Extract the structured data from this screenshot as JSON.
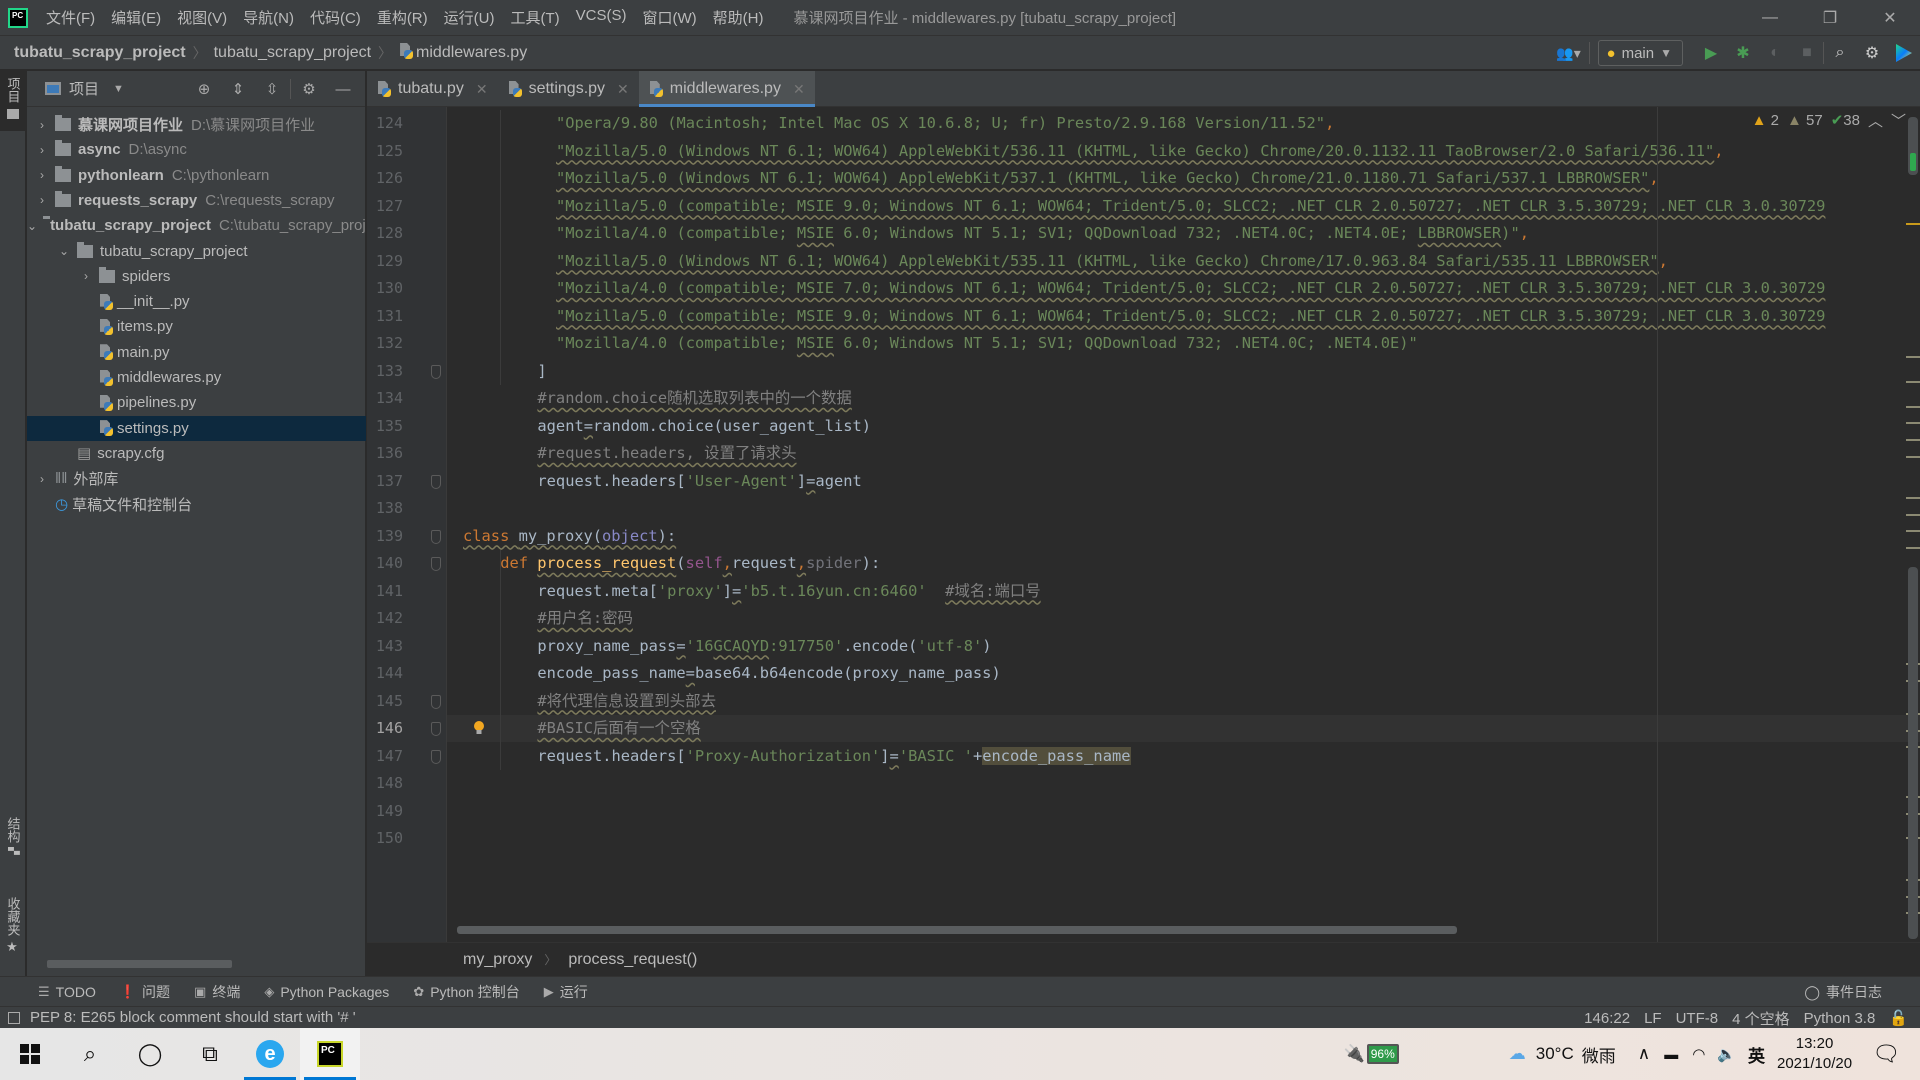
{
  "titlebar": {
    "app_icon": "pycharm-logo",
    "menu": [
      "文件(F)",
      "编辑(E)",
      "视图(V)",
      "导航(N)",
      "代码(C)",
      "重构(R)",
      "运行(U)",
      "工具(T)",
      "VCS(S)",
      "窗口(W)",
      "帮助(H)"
    ],
    "window_title": "慕课网项目作业 - middlewares.py [tubatu_scrapy_project]",
    "controls": {
      "minimize": "—",
      "restore": "❐",
      "close": "✕"
    }
  },
  "navbar": {
    "breadcrumb": [
      "tubatu_scrapy_project",
      "tubatu_scrapy_project",
      "middlewares.py"
    ],
    "run_config": "main",
    "icons": [
      "vcs-user-icon",
      "run-icon",
      "debug-icon",
      "coverage-icon",
      "stop-icon",
      "search-icon",
      "settings-icon",
      "jetbrains-toolbox-icon"
    ]
  },
  "left_strip": {
    "top_tab": "项目",
    "bottom_tabs": [
      "结构",
      "收藏夹"
    ]
  },
  "project_panel": {
    "title": "项目",
    "tree": [
      {
        "name": "慕课网项目作业",
        "path": "D:\\慕课网项目作业",
        "bold": true,
        "type": "folder",
        "expanded": false,
        "depth": 0
      },
      {
        "name": "async",
        "path": "D:\\async",
        "bold": true,
        "type": "folder",
        "expanded": false,
        "depth": 0
      },
      {
        "name": "pythonlearn",
        "path": "C:\\pythonlearn",
        "bold": true,
        "type": "folder",
        "expanded": false,
        "depth": 0
      },
      {
        "name": "requests_scrapy",
        "path": "C:\\requests_scrapy",
        "bold": true,
        "type": "folder",
        "expanded": false,
        "depth": 0
      },
      {
        "name": "tubatu_scrapy_project",
        "path": "C:\\tubatu_scrapy_project",
        "bold": true,
        "type": "folder",
        "expanded": true,
        "depth": 0
      },
      {
        "name": "tubatu_scrapy_project",
        "path": "",
        "bold": false,
        "type": "package",
        "expanded": true,
        "depth": 1
      },
      {
        "name": "spiders",
        "path": "",
        "bold": false,
        "type": "package",
        "expanded": false,
        "depth": 2
      },
      {
        "name": "__init__.py",
        "path": "",
        "bold": false,
        "type": "python",
        "depth": 2
      },
      {
        "name": "items.py",
        "path": "",
        "bold": false,
        "type": "python",
        "depth": 2
      },
      {
        "name": "main.py",
        "path": "",
        "bold": false,
        "type": "python",
        "depth": 2
      },
      {
        "name": "middlewares.py",
        "path": "",
        "bold": false,
        "type": "python",
        "depth": 2
      },
      {
        "name": "pipelines.py",
        "path": "",
        "bold": false,
        "type": "python",
        "depth": 2
      },
      {
        "name": "settings.py",
        "path": "",
        "bold": false,
        "type": "python",
        "depth": 2,
        "selected": true
      },
      {
        "name": "scrapy.cfg",
        "path": "",
        "bold": false,
        "type": "file",
        "depth": 1
      },
      {
        "name": "外部库",
        "path": "",
        "bold": false,
        "type": "library",
        "expanded": false,
        "depth": 0
      },
      {
        "name": "草稿文件和控制台",
        "path": "",
        "bold": false,
        "type": "scratch",
        "depth": 0
      }
    ]
  },
  "editor_tabs": [
    {
      "label": "tubatu.py",
      "active": false
    },
    {
      "label": "settings.py",
      "active": false
    },
    {
      "label": "middlewares.py",
      "active": true
    }
  ],
  "inspections": {
    "errors": "2",
    "warnings": "57",
    "typos": "38"
  },
  "code": {
    "current_line": 146,
    "lines": [
      {
        "n": 124,
        "indent": 10,
        "tokens": [
          [
            "s",
            "\"Opera/9.80 (Macintosh; Intel Mac OS X 10.6.8; U; fr) Presto/2.9.168 Version/11.52\""
          ],
          [
            "k",
            ","
          ]
        ]
      },
      {
        "n": 125,
        "indent": 10,
        "tokens": [
          [
            "s u",
            "\"Mozilla/5.0 (Windows NT 6.1; WOW64) AppleWebKit/536.11 (KHTML, like Gecko) Chrome/20.0.1132.11 TaoBrowser/2.0 Safari/536.11\""
          ],
          [
            "k",
            ","
          ]
        ]
      },
      {
        "n": 126,
        "indent": 10,
        "tokens": [
          [
            "s u",
            "\"Mozilla/5.0 (Windows NT 6.1; WOW64) AppleWebKit/537.1 (KHTML, like Gecko) Chrome/21.0.1180.71 Safari/537.1 LBBROWSER\""
          ],
          [
            "k",
            ","
          ]
        ]
      },
      {
        "n": 127,
        "indent": 10,
        "tokens": [
          [
            "s u",
            "\"Mozilla/5.0 (compatible; MSIE 9.0; Windows NT 6.1; WOW64; Trident/5.0; SLCC2; .NET CLR 2.0.50727; .NET CLR 3.5.30729; .NET CLR 3.0.30729"
          ]
        ]
      },
      {
        "n": 128,
        "indent": 10,
        "tokens": [
          [
            "s",
            "\"Mozilla/4.0 (compatible; "
          ],
          [
            "s u",
            "MSIE"
          ],
          [
            "s",
            " 6.0; Windows NT 5.1; SV1; QQDownload 732; .NET4.0C; .NET4.0E; "
          ],
          [
            "s u",
            "LBBROWSER"
          ],
          [
            "s",
            ")\""
          ],
          [
            "k",
            ","
          ]
        ]
      },
      {
        "n": 129,
        "indent": 10,
        "tokens": [
          [
            "s u",
            "\"Mozilla/5.0 (Windows NT 6.1; WOW64) AppleWebKit/535.11 (KHTML, like Gecko) Chrome/17.0.963.84 Safari/535.11 LBBROWSER\""
          ],
          [
            "k",
            ","
          ]
        ]
      },
      {
        "n": 130,
        "indent": 10,
        "tokens": [
          [
            "s u",
            "\"Mozilla/4.0 (compatible; MSIE 7.0; Windows NT 6.1; WOW64; Trident/5.0; SLCC2; .NET CLR 2.0.50727; .NET CLR 3.5.30729; .NET CLR 3.0.30729"
          ]
        ]
      },
      {
        "n": 131,
        "indent": 10,
        "tokens": [
          [
            "s u",
            "\"Mozilla/5.0 (compatible; MSIE 9.0; Windows NT 6.1; WOW64; Trident/5.0; SLCC2; .NET CLR 2.0.50727; .NET CLR 3.5.30729; .NET CLR 3.0.30729"
          ]
        ]
      },
      {
        "n": 132,
        "indent": 10,
        "tokens": [
          [
            "s",
            "\"Mozilla/4.0 (compatible; "
          ],
          [
            "s u",
            "MSIE"
          ],
          [
            "s",
            " 6.0; Windows NT 5.1; SV1; QQDownload 732; .NET4.0C; .NET4.0E)\""
          ]
        ]
      },
      {
        "n": 133,
        "indent": 8,
        "tokens": [
          [
            "p",
            "]"
          ]
        ]
      },
      {
        "n": 134,
        "indent": 8,
        "tokens": [
          [
            "c u",
            "#random.choice随机选取列表中的一个数据"
          ]
        ]
      },
      {
        "n": 135,
        "indent": 8,
        "tokens": [
          [
            "p",
            "agent"
          ],
          [
            "p u",
            "="
          ],
          [
            "p",
            "random.choice(user_agent_list)"
          ]
        ]
      },
      {
        "n": 136,
        "indent": 8,
        "tokens": [
          [
            "c u",
            "#request.headers, 设置了请求头"
          ]
        ]
      },
      {
        "n": 137,
        "indent": 8,
        "tokens": [
          [
            "p",
            "request.headers["
          ],
          [
            "s",
            "'User-Agent'"
          ],
          [
            "p",
            "]"
          ],
          [
            "p u",
            "="
          ],
          [
            "p",
            "agent"
          ]
        ]
      },
      {
        "n": 138,
        "indent": 0,
        "tokens": []
      },
      {
        "n": 139,
        "indent": 0,
        "tokens": [
          [
            "k u",
            "class "
          ],
          [
            "p u",
            "my_proxy("
          ],
          [
            "o u",
            "object"
          ],
          [
            "p u",
            "):"
          ]
        ]
      },
      {
        "n": 140,
        "indent": 4,
        "tokens": [
          [
            "k",
            "def "
          ],
          [
            "f u",
            "process_request"
          ],
          [
            "p",
            "("
          ],
          [
            "self",
            "self"
          ],
          [
            "k u",
            ","
          ],
          [
            "p",
            "request"
          ],
          [
            "k u",
            ","
          ],
          [
            "gray-param",
            "spider"
          ],
          [
            "p",
            "):"
          ]
        ]
      },
      {
        "n": 141,
        "indent": 8,
        "tokens": [
          [
            "p",
            "request.meta["
          ],
          [
            "s",
            "'proxy'"
          ],
          [
            "p",
            "]"
          ],
          [
            "p u",
            "="
          ],
          [
            "s",
            "'b5.t.16yun.cn:6460'"
          ],
          [
            "p",
            "  "
          ],
          [
            "c u",
            "#域名:端口号"
          ]
        ]
      },
      {
        "n": 142,
        "indent": 8,
        "tokens": [
          [
            "c u",
            "#用户名:密码"
          ]
        ]
      },
      {
        "n": 143,
        "indent": 8,
        "tokens": [
          [
            "p",
            "proxy_name_pass"
          ],
          [
            "p u",
            "="
          ],
          [
            "s",
            "'16"
          ],
          [
            "s u",
            "GCAQYD"
          ],
          [
            "s",
            ":917750'"
          ],
          [
            "p",
            ".encode("
          ],
          [
            "s",
            "'utf-8'"
          ],
          [
            "p",
            ")"
          ]
        ]
      },
      {
        "n": 144,
        "indent": 8,
        "tokens": [
          [
            "p",
            "encode_pass_name"
          ],
          [
            "p u",
            "="
          ],
          [
            "p",
            "base64.b64encode(proxy_name_pass)"
          ]
        ]
      },
      {
        "n": 145,
        "indent": 8,
        "tokens": [
          [
            "c u",
            "#将代理信息设置到头部去"
          ]
        ]
      },
      {
        "n": 146,
        "indent": 8,
        "tokens": [
          [
            "c u",
            "#BASIC后面有一个空格"
          ]
        ]
      },
      {
        "n": 147,
        "indent": 8,
        "tokens": [
          [
            "p",
            "request.headers["
          ],
          [
            "s",
            "'Proxy-Authorization'"
          ],
          [
            "p",
            "]"
          ],
          [
            "p u",
            "="
          ],
          [
            "s",
            "'BASIC '"
          ],
          [
            "p",
            "+"
          ],
          [
            "p hl",
            "encode_pass_name"
          ]
        ]
      },
      {
        "n": 148,
        "indent": 0,
        "tokens": []
      },
      {
        "n": 149,
        "indent": 0,
        "tokens": []
      },
      {
        "n": 150,
        "indent": 0,
        "tokens": []
      }
    ]
  },
  "code_breadcrumb": [
    "my_proxy",
    "process_request()"
  ],
  "toolwindows": [
    {
      "icon": "list-icon",
      "glyph": "☰",
      "label": "TODO"
    },
    {
      "icon": "problems-icon",
      "glyph": "❗",
      "label": "问题"
    },
    {
      "icon": "terminal-icon",
      "glyph": "▣",
      "label": "终端"
    },
    {
      "icon": "packages-icon",
      "glyph": "◈",
      "label": "Python Packages"
    },
    {
      "icon": "python-console-icon",
      "glyph": "✿",
      "label": "Python 控制台"
    },
    {
      "icon": "run-icon",
      "glyph": "▶",
      "label": "运行"
    }
  ],
  "event_log": "事件日志",
  "statusbar": {
    "message": "PEP 8: E265 block comment should start with '# '",
    "position": "146:22",
    "line_sep": "LF",
    "encoding": "UTF-8",
    "indent": "4 个空格",
    "interpreter": "Python 3.8"
  },
  "taskbar": {
    "apps": [
      "start-icon",
      "search-icon",
      "cortana-icon",
      "task-view-icon",
      "edge-browser-icon",
      "pycharm-icon"
    ],
    "battery": "96%",
    "weather_temp": "30°C",
    "weather_desc": "微雨",
    "ime": "英",
    "time": "13:20",
    "date": "2021/10/20"
  }
}
